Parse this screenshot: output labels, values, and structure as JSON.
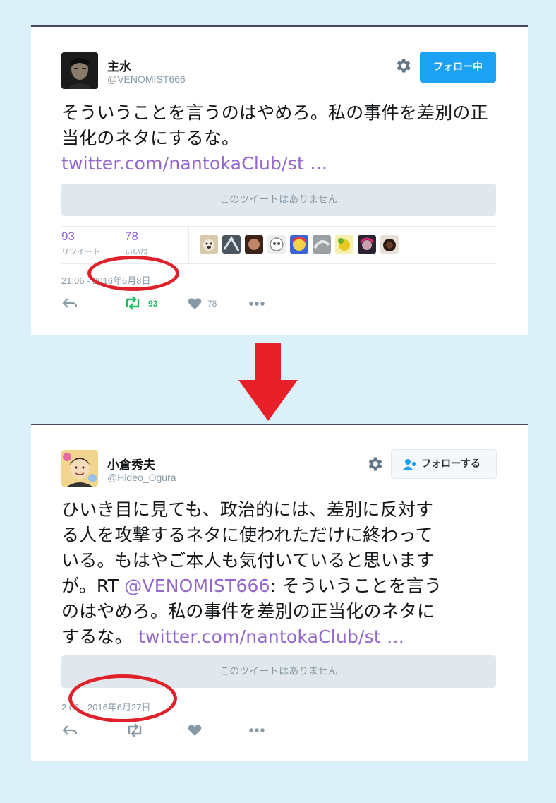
{
  "tweet1": {
    "name": "主水",
    "handle": "@VENOMIST666",
    "follow_label": "フォロー中",
    "text": "そういうことを言うのはやめろ。私の事件を差別の正当化のネタにするな。",
    "link": "twitter.com/nantokaClub/st …",
    "unavailable": "このツイートはありません",
    "retweets": "93",
    "retweets_label": "リツイート",
    "likes": "78",
    "likes_label": "いいね",
    "time": "21:06",
    "date": "2016年6月8日",
    "action_rt": "93",
    "action_like": "78"
  },
  "tweet2": {
    "name": "小倉秀夫",
    "handle": "@Hideo_Ogura",
    "follow_label": "フォローする",
    "text_line1": "ひいき目に見ても、政治的には、差別に反対す",
    "text_line2": "る人を攻撃するネタに使われただけに終わって",
    "text_line3": "いる。もはやご本人も気付いていると思います",
    "text_line4_pre": "が。RT ",
    "mention": "@VENOMIST666",
    "text_line4_post": ": そういうことを言う",
    "text_line5": "のはやめろ。私の事件を差別の正当化のネタに",
    "text_line6": "するな。 ",
    "link": "twitter.com/nantokaClub/st …",
    "unavailable": "このツイートはありません",
    "time": "2:06",
    "date": "2016年6月27日"
  },
  "colors": {
    "accent": "#1da1f2",
    "link": "#9266cc",
    "annotation": "#e0202a",
    "retweet_green": "#17bf63",
    "background": "#dcf0f9"
  },
  "icons": [
    "gear-icon",
    "reply-icon",
    "retweet-icon",
    "heart-icon",
    "more-icon",
    "add-user-icon",
    "arrow-down-icon"
  ]
}
